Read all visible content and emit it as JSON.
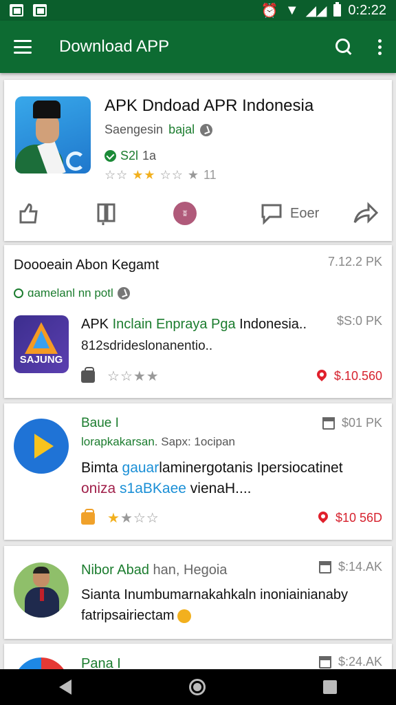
{
  "status_bar": {
    "time": "0:2:22"
  },
  "app_bar": {
    "title": "Download APP"
  },
  "featured": {
    "title": "APK Dndoad APR Indonesia",
    "developer_prefix": "Saengesin",
    "developer_name": "bajal",
    "size_label": "S2l",
    "size_value": "1a",
    "stars_off_left": "☆☆",
    "stars_on": "★★",
    "stars_off_right": "☆☆",
    "rating_count": "11",
    "action_label": "Eoer",
    "chip_text": "ʬ"
  },
  "list_header": {
    "title": "Doooeain Abon Kegamt",
    "size": "7.12.2 PK",
    "tag": "ɑamelanl nn potl"
  },
  "item1": {
    "icon_label": "SAJUNG",
    "title_a": "APK ",
    "title_b": "Inclain Enpraya Pga",
    "title_c": " Indonesia..",
    "subtitle": "812sdrideslonanentio..",
    "size": "$S:0 PK",
    "stars_off": "☆★★",
    "price": "$.10.560"
  },
  "item2": {
    "name": "Baue I",
    "sub_a": "lorapkakarsan",
    "sub_b": ". Sapx: 1ocipan",
    "size": "$01 PK",
    "desc1_a": "Bimta ",
    "desc1_b": "gauar",
    "desc1_c": "laminergotanis Ipersiocatinet",
    "desc2_a": "oniza ",
    "desc2_b": "s1aBKaee",
    "desc2_c": " vienaH....",
    "stars_on": "★",
    "stars_off": "★☆☆",
    "price": "$10 56D"
  },
  "item3": {
    "name": "Nibor Abad",
    "name_b": " han, Hegoia",
    "size": "$:14.AK",
    "desc1": "Sianta Inumbumarnakahkaln inoniainianaby",
    "desc2": "fatripsairiectam"
  },
  "item4": {
    "name": "Pana I",
    "size": "$:24.AK"
  },
  "colors": {
    "primary_dark": "#0b5e2c",
    "primary": "#0d6b32",
    "accent_green": "#1b7c2e",
    "sale_red": "#d6222e",
    "star": "#f2b01e"
  }
}
